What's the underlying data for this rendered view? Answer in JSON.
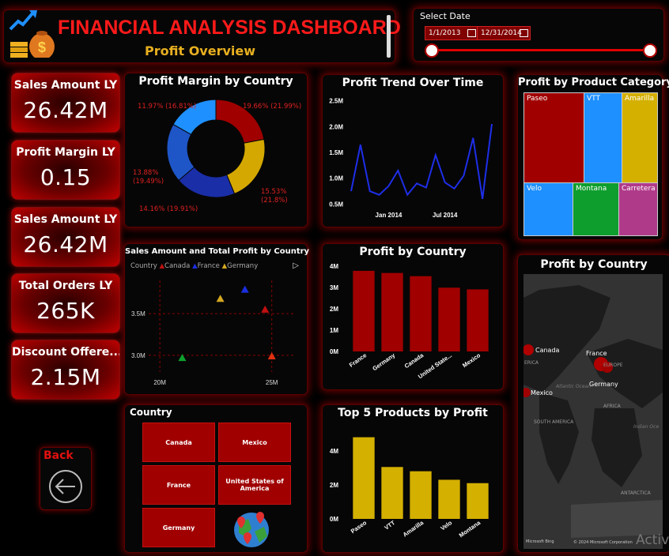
{
  "header": {
    "title": "FINANCIAL ANALYSIS DASHBOARD",
    "subtitle": "Profit Overview"
  },
  "date_filter": {
    "label": "Select Date",
    "start": "1/1/2013",
    "end": "12/31/2014"
  },
  "kpis": [
    {
      "label": "Sales Amount LY",
      "value": "26.42M"
    },
    {
      "label": "Profit Margin LY",
      "value": "0.15"
    },
    {
      "label": "Sales Amount LY",
      "value": "26.42M"
    },
    {
      "label": "Total Orders LY",
      "value": "265K"
    },
    {
      "label": "Discount Offere...",
      "value": "2.15M"
    }
  ],
  "back": {
    "label": "Back"
  },
  "colors": {
    "accent_red": "#a00000",
    "bright_red": "#ff1a1a",
    "gold": "#d4a820",
    "blue": "#1e90ff",
    "dark_blue": "#1a2ea8"
  },
  "profit_margin": {
    "title": "Profit Margin by Country",
    "labels": [
      "11.97% (16.81%)",
      "19.66% (21.99%)",
      "13.88% (19.49%)",
      "15.53% (21.8%)",
      "14.16% (19.91%)"
    ]
  },
  "trend": {
    "title": "Profit Trend Over Time",
    "y_ticks": [
      "2.5M",
      "2.0M",
      "1.5M",
      "1.0M",
      "0.5M"
    ],
    "x_ticks": [
      "Jan 2014",
      "Jul 2014"
    ]
  },
  "treemap": {
    "title": "Profit by Product Category",
    "items": [
      {
        "name": "Paseo",
        "color": "#a00000"
      },
      {
        "name": "VTT",
        "color": "#1e90ff"
      },
      {
        "name": "Amarilla",
        "color": "#d4b000"
      },
      {
        "name": "Velo",
        "color": "#1e90ff"
      },
      {
        "name": "Montana",
        "color": "#0e9e2e"
      },
      {
        "name": "Carretera",
        "color": "#b03a8a"
      }
    ]
  },
  "scatter": {
    "title": "Sales Amount and Total Profit by Country",
    "legend_title": "Country",
    "legend": [
      {
        "name": "Canada",
        "color": "#c01010"
      },
      {
        "name": "France",
        "color": "#1a2ee0"
      },
      {
        "name": "Germany",
        "color": "#d4a820"
      }
    ],
    "y_ticks": [
      "3.5M",
      "3.0M"
    ],
    "x_ticks": [
      "20M",
      "25M"
    ]
  },
  "country_slicer": {
    "title": "Country",
    "items": [
      "Canada",
      "Mexico",
      "France",
      "United States of America",
      "Germany"
    ]
  },
  "map": {
    "title": "Profit by Country",
    "labels": [
      "Canada",
      "France",
      "Germany",
      "Mexico",
      "EUROPE",
      "AFRICA",
      "SOUTH AMERICA",
      "Atlantic Ocean",
      "Indian Oce",
      "ANTARCTICA",
      "ERICA"
    ],
    "footer_left": "Microsoft Bing",
    "footer_right": "© 2024 Microsoft Corporation"
  },
  "watermark": "Activ",
  "chart_data": [
    {
      "type": "pie",
      "title": "Profit Margin by Country",
      "slices": [
        {
          "label": "19.66% (21.99%)",
          "value": 21.99,
          "color": "#a00000"
        },
        {
          "label": "15.53% (21.8%)",
          "value": 21.8,
          "color": "#d4a800"
        },
        {
          "label": "14.16% (19.91%)",
          "value": 19.91,
          "color": "#1a2ea8"
        },
        {
          "label": "13.88% (19.49%)",
          "value": 19.49,
          "color": "#1e56c8"
        },
        {
          "label": "11.97% (16.81%)",
          "value": 16.81,
          "color": "#1e90ff"
        }
      ]
    },
    {
      "type": "line",
      "title": "Profit Trend Over Time",
      "x": [
        "2013-09",
        "2013-10",
        "2013-11",
        "2013-12",
        "2014-01",
        "2014-02",
        "2014-03",
        "2014-04",
        "2014-05",
        "2014-06",
        "2014-07",
        "2014-08",
        "2014-09",
        "2014-10",
        "2014-11",
        "2014-12"
      ],
      "values": [
        0.75,
        1.65,
        0.75,
        0.68,
        0.85,
        1.15,
        0.68,
        0.9,
        0.82,
        1.45,
        0.92,
        0.8,
        1.05,
        1.78,
        0.6,
        2.05
      ],
      "ylim": [
        0.4,
        2.6
      ]
    },
    {
      "type": "scatter",
      "title": "Sales Amount and Total Profit by Country",
      "points": [
        {
          "name": "Germany",
          "x": 21.0,
          "y": 2.97,
          "color": "#0ea02e"
        },
        {
          "name": "Germany",
          "x": 22.7,
          "y": 3.68,
          "color": "#d4a820"
        },
        {
          "name": "France",
          "x": 23.8,
          "y": 3.79,
          "color": "#1a2ee0"
        },
        {
          "name": "Canada",
          "x": 24.7,
          "y": 3.55,
          "color": "#c01010"
        },
        {
          "name": "Canada",
          "x": 25.0,
          "y": 2.99,
          "color": "#e03010"
        }
      ],
      "xlim": [
        19.5,
        26.0
      ],
      "ylim": [
        2.8,
        3.9
      ]
    },
    {
      "type": "bar",
      "title": "Profit by Country",
      "categories": [
        "France",
        "Germany",
        "Canada",
        "United State...",
        "Mexico"
      ],
      "values": [
        3.78,
        3.68,
        3.53,
        2.99,
        2.91
      ],
      "y_ticks": [
        "4M",
        "3M",
        "2M",
        "1M",
        "0M"
      ],
      "ylim": [
        0,
        4
      ],
      "color": "#a00000"
    },
    {
      "type": "bar",
      "title": "Top 5 Products by Profit",
      "categories": [
        "Paseo",
        "VTT",
        "Amarilla",
        "Velo",
        "Montana"
      ],
      "values": [
        4.8,
        3.05,
        2.8,
        2.3,
        2.1
      ],
      "y_ticks": [
        "4M",
        "2M",
        "0M"
      ],
      "ylim": [
        0,
        5.2
      ],
      "color": "#d4b000"
    }
  ]
}
